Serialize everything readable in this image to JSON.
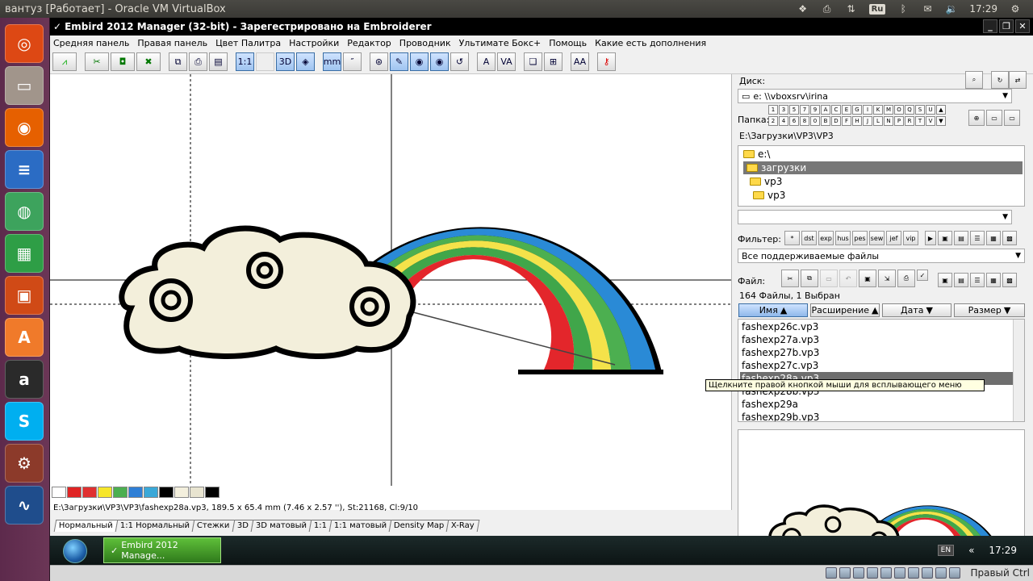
{
  "host": {
    "window_title": "вантуз [Работает] - Oracle VM VirtualBox",
    "clock": "17:29",
    "keyboard_layout": "Ru",
    "host_key_label": "Правый Ctrl"
  },
  "launcher": {
    "items": [
      {
        "name": "ubuntu-dash",
        "color": "#dd4814",
        "glyph": "◎"
      },
      {
        "name": "files",
        "color": "#a1958b",
        "glyph": "▭"
      },
      {
        "name": "firefox",
        "color": "#e66000",
        "glyph": "◉"
      },
      {
        "name": "writer",
        "color": "#2b6cc4",
        "glyph": "≡"
      },
      {
        "name": "chrome",
        "color": "#3da35d",
        "glyph": "◍"
      },
      {
        "name": "calc",
        "color": "#2e9e46",
        "glyph": "▦"
      },
      {
        "name": "impress",
        "color": "#d04a16",
        "glyph": "▣"
      },
      {
        "name": "software-center",
        "color": "#f07a2a",
        "glyph": "A"
      },
      {
        "name": "amazon",
        "color": "#2a2a2a",
        "glyph": "a"
      },
      {
        "name": "skype",
        "color": "#00aff0",
        "glyph": "S"
      },
      {
        "name": "settings",
        "color": "#8c3a2a",
        "glyph": "⚙"
      },
      {
        "name": "system-monitor",
        "color": "#1f4d8c",
        "glyph": "∿"
      }
    ]
  },
  "app": {
    "title": "Embird 2012 Manager (32-bit) - Зарегестрировано на Embroiderer",
    "menu": [
      "Средняя панель",
      "Правая панель",
      "Цвет Палитра",
      "Настройки",
      "Редактор",
      "Проводник",
      "Ультимате Бокс+",
      "Помощь",
      "Какие есть дополнения"
    ],
    "toolbar": {
      "one_to_one": "1:1",
      "three_d": "3D",
      "mm": "mm",
      "text_a": "A",
      "text_va": "VA",
      "text_aa": "AA"
    },
    "palette": [
      "#ffffff",
      "#e02424",
      "#e03030",
      "#f6e62a",
      "#4caf50",
      "#2f7fd6",
      "#3aa8d8",
      "#000000",
      "#f3efdd",
      "#e8e4d0",
      "#000000"
    ],
    "status_line": "E:\\Загрузки\\VP3\\VP3\\fashexp28a.vp3, 189.5 x 65.4 mm (7.46 x 2.57 ''), St:21168, Cl:9/10",
    "view_tabs": [
      "Нормальный",
      "1:1 Нормальный",
      "Стежки",
      "3D",
      "3D матовый",
      "1:1",
      "1:1 матовый",
      "Density Map",
      "X-Ray"
    ],
    "right_panel": {
      "disk_label": "Диск:",
      "disk_value": "e: \\\\vboxsrv\\irina",
      "folder_label": "Папка:",
      "key_row1": [
        "1",
        "3",
        "5",
        "7",
        "9",
        "A",
        "C",
        "E",
        "G",
        "I",
        "K",
        "M",
        "O",
        "Q",
        "S",
        "U"
      ],
      "key_row2": [
        "2",
        "4",
        "6",
        "8",
        "0",
        "B",
        "D",
        "F",
        "H",
        "J",
        "L",
        "N",
        "P",
        "R",
        "T",
        "V"
      ],
      "current_path": "E:\\Загрузки\\VP3\\VP3",
      "tree": [
        {
          "label": "e:\\",
          "indent": 0,
          "selected": false
        },
        {
          "label": "загрузки",
          "indent": 1,
          "selected": true
        },
        {
          "label": "vp3",
          "indent": 2,
          "selected": false
        },
        {
          "label": "vp3",
          "indent": 3,
          "selected": false
        }
      ],
      "filter_label": "Фильтер:",
      "filter_buttons": [
        "*",
        "dst",
        "exp",
        "hus",
        "pes",
        "sew",
        "jef",
        "vip"
      ],
      "filter_value": "Все поддерживаемые файлы",
      "file_label": "Файл:",
      "file_count": "164 Файлы, 1 Выбран",
      "columns": [
        "Имя",
        "Расширение",
        "Дата",
        "Размер"
      ],
      "files": [
        {
          "name": "fashexp26c.vp3",
          "selected": false
        },
        {
          "name": "fashexp27a.vp3",
          "selected": false
        },
        {
          "name": "fashexp27b.vp3",
          "selected": false
        },
        {
          "name": "fashexp27c.vp3",
          "selected": false
        },
        {
          "name": "fashexp28a.vp3",
          "selected": true
        },
        {
          "name": "fashexp28b.vp3",
          "selected": false
        },
        {
          "name": "fashexp29a",
          "selected": false
        },
        {
          "name": "fashexp29b.vp3",
          "selected": false
        }
      ],
      "tooltip": "Щелкните правой кнопкой мыши для всплывающего меню"
    }
  },
  "taskbar": {
    "task_label": "Embird 2012 Manage...",
    "lang": "EN",
    "clock": "17:29",
    "chevron": "«"
  }
}
